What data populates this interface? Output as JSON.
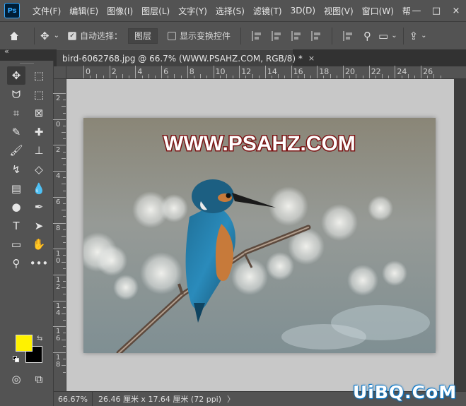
{
  "app": {
    "logo_text": "Ps"
  },
  "menu": [
    "文件(F)",
    "编辑(E)",
    "图像(I)",
    "图层(L)",
    "文字(Y)",
    "选择(S)",
    "滤镜(T)",
    "3D(D)",
    "视图(V)",
    "窗口(W)",
    "帮"
  ],
  "window_controls": {
    "minimize": "—",
    "restore": "□",
    "close": "×"
  },
  "options": {
    "auto_select_label": "自动选择：",
    "auto_select_checked": true,
    "auto_select_target": "图层",
    "show_transform_label": "显示变换控件",
    "show_transform_checked": false
  },
  "tab": {
    "title": "bird-6062768.jpg @ 66.7% (WWW.PSAHZ.COM, RGB/8) *",
    "close": "×"
  },
  "collapse_label": "«",
  "ruler_h": [
    "0",
    "2",
    "4",
    "6",
    "8",
    "10",
    "12",
    "14",
    "16",
    "18",
    "20",
    "22",
    "24",
    "26"
  ],
  "ruler_v": [
    "2",
    "0",
    "2",
    "4",
    "6",
    "8",
    "1\n0",
    "1\n2",
    "1\n4",
    "1\n6",
    "1\n8"
  ],
  "document": {
    "overlay_text": "WWW.PSAHZ.COM"
  },
  "colors": {
    "foreground": "#fff200",
    "background": "#000000",
    "swap_glyph": "⇆"
  },
  "status": {
    "zoom": "66.67%",
    "doc_info": "26.46 厘米 x 17.64 厘米 (72 ppi)",
    "arrow": "〉"
  },
  "watermark": "UiBQ.CoM",
  "tools": [
    {
      "name": "move-tool-icon",
      "glyph": "✥"
    },
    {
      "name": "marquee-tool-icon",
      "glyph": "⬚"
    },
    {
      "name": "lasso-tool-icon",
      "glyph": "ᗢ"
    },
    {
      "name": "object-select-tool-icon",
      "glyph": "⬚"
    },
    {
      "name": "crop-tool-icon",
      "glyph": "⌗"
    },
    {
      "name": "frame-tool-icon",
      "glyph": "⊠"
    },
    {
      "name": "eyedropper-tool-icon",
      "glyph": "✎"
    },
    {
      "name": "spot-healing-tool-icon",
      "glyph": "✚"
    },
    {
      "name": "brush-tool-icon",
      "glyph": "🖌"
    },
    {
      "name": "clone-stamp-tool-icon",
      "glyph": "⊥"
    },
    {
      "name": "history-brush-tool-icon",
      "glyph": "↯"
    },
    {
      "name": "eraser-tool-icon",
      "glyph": "◇"
    },
    {
      "name": "gradient-tool-icon",
      "glyph": "▤"
    },
    {
      "name": "blur-tool-icon",
      "glyph": "💧"
    },
    {
      "name": "dodge-tool-icon",
      "glyph": "●"
    },
    {
      "name": "pen-tool-icon",
      "glyph": "✒"
    },
    {
      "name": "type-tool-icon",
      "glyph": "T"
    },
    {
      "name": "path-select-tool-icon",
      "glyph": "➤"
    },
    {
      "name": "rectangle-tool-icon",
      "glyph": "▭"
    },
    {
      "name": "hand-tool-icon",
      "glyph": "✋"
    },
    {
      "name": "zoom-tool-icon",
      "glyph": "⚲"
    },
    {
      "name": "more-tools-icon",
      "glyph": "•••"
    }
  ]
}
